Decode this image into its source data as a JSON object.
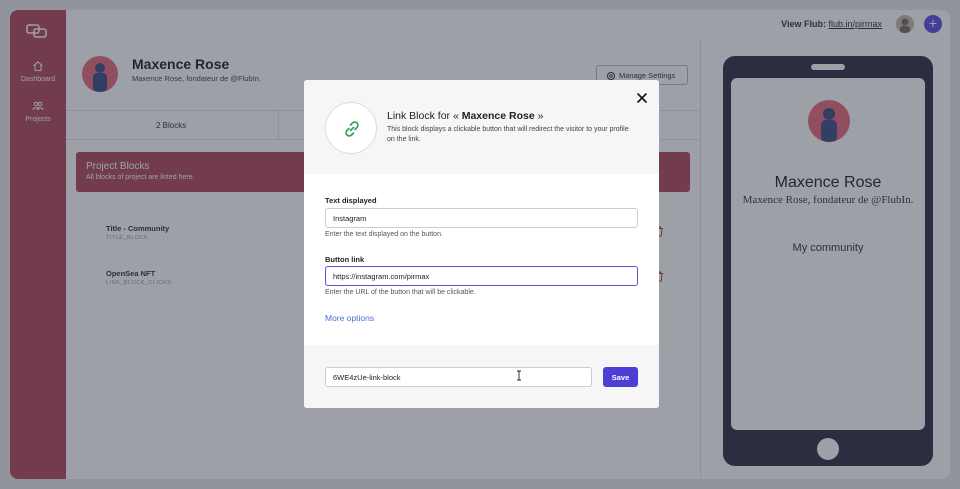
{
  "sidebar": {
    "items": [
      {
        "label": "Dashboard",
        "icon": "home-icon"
      },
      {
        "label": "Projects",
        "icon": "users-icon"
      }
    ]
  },
  "topbar": {
    "view_label": "View Flub:",
    "view_link": "flub.in/pirmax"
  },
  "profile": {
    "name": "Maxence Rose",
    "subtitle": "Maxence Rose, fondateur de @FlubIn.",
    "manage_label": "Manage Settings"
  },
  "tabs": [
    {
      "label": "2 Blocks"
    }
  ],
  "blocks": {
    "title": "Project Blocks",
    "subtitle": "All blocks of project are listed here.",
    "rows": [
      {
        "title": "Title - Community",
        "type": "TITLE_BLOCK"
      },
      {
        "title": "OpenSea NFT",
        "type": "LINK_BLOCK_CLICKS"
      }
    ]
  },
  "preview": {
    "name": "Maxence Rose",
    "subtitle": "Maxence Rose, fondateur de @FlubIn.",
    "link": "My community"
  },
  "modal": {
    "title_prefix": "Link Block for «",
    "title_name": "Maxence Rose",
    "title_suffix": "»",
    "description": "This block displays a clickable button that will redirect the visitor to your profile on the link.",
    "text_label": "Text displayed",
    "text_value": "Instagram",
    "text_help": "Enter the text displayed on the button.",
    "link_label": "Button link",
    "link_value": "https://instagram.com/pirmax",
    "link_help": "Enter the URL of the button that will be clickable.",
    "more_options": "More options",
    "block_id": "6WE4zUe-link-block",
    "save_label": "Save"
  },
  "colors": {
    "sidebar": "#b04a5c",
    "accent": "#4b3fd6",
    "link": "#4a6fd8",
    "phone": "#2e3044"
  }
}
